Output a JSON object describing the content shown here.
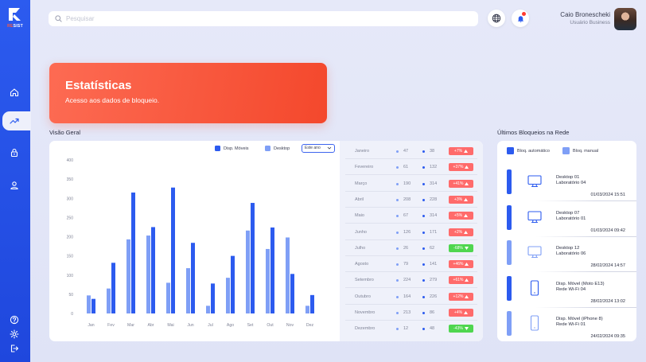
{
  "app": {
    "logo_prefix": "RE",
    "logo_suffix": "SIST"
  },
  "search": {
    "placeholder": "Pesquisar"
  },
  "user": {
    "name": "Caio Bronescheki",
    "role": "Usuário Business"
  },
  "banner": {
    "title": "Estatísticas",
    "subtitle": "Acesso aos dados de bloqueio."
  },
  "overview": {
    "title": "Visão Geral",
    "legend_mobile": "Disp. Móveis",
    "legend_desktop": "Desktop",
    "period": "Este ano"
  },
  "recent": {
    "title": "Últimos Bloqueios na Rede",
    "legend_auto": "Bloq. automático",
    "legend_manual": "Bloq. manual",
    "items": [
      {
        "type": "desktop",
        "mode": "auto",
        "title": "Desktop 01",
        "sub": "Laboratório 04",
        "date": "01/03/2024 15:51"
      },
      {
        "type": "desktop",
        "mode": "auto",
        "title": "Desktop 07",
        "sub": "Laboratório 01",
        "date": "01/03/2024 09:42"
      },
      {
        "type": "desktop",
        "mode": "manual",
        "title": "Desktop 12",
        "sub": "Laboratório 06",
        "date": "28/02/2024 14:57"
      },
      {
        "type": "phone",
        "mode": "auto",
        "title": "Disp. Móvel (Moto E13)",
        "sub": "Rede Wi-Fi 04",
        "date": "28/02/2024 13:02"
      },
      {
        "type": "phone",
        "mode": "manual",
        "title": "Disp. Móvel (iPhone 8)",
        "sub": "Rede Wi-Fi 01",
        "date": "24/02/2024 09:35"
      }
    ]
  },
  "table": [
    {
      "month": "Janeiro",
      "mobile": "47",
      "desktop": "38",
      "change": "+7%",
      "dir": "up"
    },
    {
      "month": "Fevereiro",
      "mobile": "61",
      "desktop": "132",
      "change": "+37%",
      "dir": "up"
    },
    {
      "month": "Março",
      "mobile": "190",
      "desktop": "314",
      "change": "+41%",
      "dir": "up"
    },
    {
      "month": "Abril",
      "mobile": "208",
      "desktop": "228",
      "change": "+3%",
      "dir": "up"
    },
    {
      "month": "Maio",
      "mobile": "67",
      "desktop": "314",
      "change": "+5%",
      "dir": "up"
    },
    {
      "month": "Junho",
      "mobile": "126",
      "desktop": "171",
      "change": "+2%",
      "dir": "up"
    },
    {
      "month": "Julho",
      "mobile": "26",
      "desktop": "62",
      "change": "-68%",
      "dir": "down"
    },
    {
      "month": "Agosto",
      "mobile": "79",
      "desktop": "141",
      "change": "+46%",
      "dir": "up"
    },
    {
      "month": "Setembro",
      "mobile": "224",
      "desktop": "279",
      "change": "+61%",
      "dir": "up"
    },
    {
      "month": "Outubro",
      "mobile": "164",
      "desktop": "226",
      "change": "+12%",
      "dir": "up"
    },
    {
      "month": "Novembro",
      "mobile": "213",
      "desktop": "86",
      "change": "+4%",
      "dir": "up"
    },
    {
      "month": "Dezembro",
      "mobile": "12",
      "desktop": "48",
      "change": "-43%",
      "dir": "down"
    }
  ],
  "colors": {
    "primary": "#2c5bef",
    "desktop_bar": "#7f9ff6",
    "accent_orange": "#f4482c",
    "badge_up": "#ff6b6b",
    "badge_down": "#4fd64f"
  },
  "chart_data": {
    "type": "bar",
    "categories": [
      "Jan",
      "Fev",
      "Mar",
      "Abr",
      "Mai",
      "Jun",
      "Jul",
      "Ago",
      "Set",
      "Out",
      "Nov",
      "Dez"
    ],
    "series": [
      {
        "name": "Desktop",
        "values": [
          47,
          65,
          193,
          203,
          80,
          118,
          20,
          93,
          216,
          168,
          198,
          20
        ]
      },
      {
        "name": "Disp. Móveis",
        "values": [
          38,
          132,
          315,
          225,
          328,
          184,
          78,
          150,
          288,
          224,
          103,
          48
        ]
      }
    ],
    "yticks": [
      0,
      50,
      100,
      150,
      200,
      250,
      300,
      350,
      400
    ],
    "ylim": [
      0,
      400
    ],
    "title": "",
    "xlabel": "",
    "ylabel": ""
  }
}
